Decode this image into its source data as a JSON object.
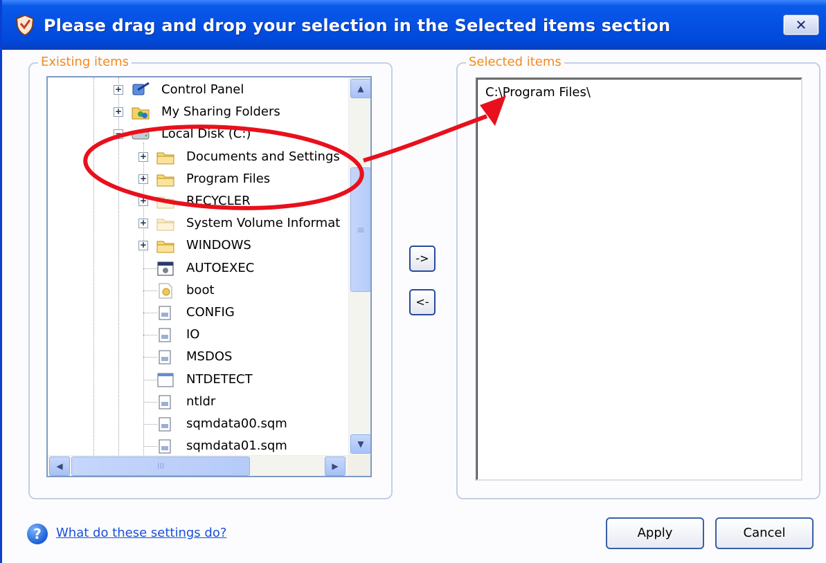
{
  "window": {
    "title": "Please drag and drop your selection in the Selected items section",
    "close_label": "✕"
  },
  "existing": {
    "legend": "Existing items",
    "tree": [
      {
        "label": "Control Panel",
        "icon": "control-panel-icon",
        "level": 1,
        "expander": "+"
      },
      {
        "label": "My Sharing Folders",
        "icon": "sharing-folder-icon",
        "level": 1,
        "expander": "+"
      },
      {
        "label": "Local Disk (C:)",
        "icon": "disk-icon",
        "level": 1,
        "expander": "−"
      },
      {
        "label": "Documents and Settings",
        "icon": "folder-icon",
        "level": 2,
        "expander": "+"
      },
      {
        "label": "Program Files",
        "icon": "folder-icon",
        "level": 2,
        "expander": "+"
      },
      {
        "label": "RECYCLER",
        "icon": "folder-faded-icon",
        "level": 2,
        "expander": "+"
      },
      {
        "label": "System Volume Informat",
        "icon": "folder-faded-icon",
        "level": 2,
        "expander": "+"
      },
      {
        "label": "WINDOWS",
        "icon": "folder-icon",
        "level": 2,
        "expander": "+"
      },
      {
        "label": "AUTOEXEC",
        "icon": "batch-file-icon",
        "level": 2,
        "expander": ""
      },
      {
        "label": "boot",
        "icon": "settings-file-icon",
        "level": 2,
        "expander": ""
      },
      {
        "label": "CONFIG",
        "icon": "system-file-icon",
        "level": 2,
        "expander": ""
      },
      {
        "label": "IO",
        "icon": "system-file-icon",
        "level": 2,
        "expander": ""
      },
      {
        "label": "MSDOS",
        "icon": "system-file-icon",
        "level": 2,
        "expander": ""
      },
      {
        "label": "NTDETECT",
        "icon": "application-file-icon",
        "level": 2,
        "expander": ""
      },
      {
        "label": "ntldr",
        "icon": "system-file-icon",
        "level": 2,
        "expander": ""
      },
      {
        "label": "sqmdata00.sqm",
        "icon": "system-file-icon",
        "level": 2,
        "expander": ""
      },
      {
        "label": "sqmdata01.sqm",
        "icon": "system-file-icon",
        "level": 2,
        "expander": ""
      }
    ],
    "scroll_thumb_grip": "≡",
    "hscroll_thumb_grip": "III"
  },
  "move": {
    "add_label": "->",
    "remove_label": "<-"
  },
  "selected": {
    "legend": "Selected items",
    "items": [
      "C:\\Program Files\\"
    ]
  },
  "footer": {
    "help_text": "What do these settings do?",
    "apply_label": "Apply",
    "cancel_label": "Cancel"
  },
  "annotation": {
    "color": "#e8101c"
  }
}
